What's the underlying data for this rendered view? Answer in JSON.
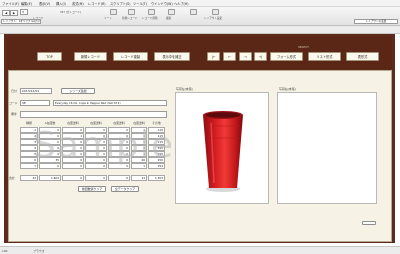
{
  "menu": [
    "ファイル(F)",
    "編集(E)",
    "表示(V)",
    "挿入(I)",
    "書式(M)",
    "レコード(R)",
    "スクリプト(S)",
    "ツール(T)",
    "ウインドウ(W)",
    "ヘルプ(H)"
  ],
  "toolbar": {
    "record_label": "レコード",
    "count_value": "337 (全レコード)",
    "record_number": "3",
    "sort_label": "ソート",
    "new_record_label": "新規レコード",
    "delete_record_label": "レコード削除",
    "find_label": "検索",
    "layout_label": "レイアウト設定",
    "layout_value": "レイアウト: 【オリジナルAのジ..."
  },
  "header": {
    "select_label": "SELECT",
    "buttons": {
      "top": "TOP",
      "new_record": "新規レコード",
      "copy_record": "レコード複製",
      "delete_current": "表示中を補正",
      "first": "|←",
      "prev": "←",
      "next": "→",
      "last": "→|",
      "form_view": "フォーム形式",
      "list_view": "リスト形式",
      "table_view": "表形式"
    }
  },
  "form": {
    "date_label": "日付",
    "date_value": "2013/12/01",
    "date_button": "シリーズ追加",
    "code_label": "コード",
    "code_value": "SE",
    "code_checkbox_label": "ソーダ/ド",
    "name_value": "Everyday 16 Oz. Cups In Pepper Red (Set Of 4)",
    "note_label": "備考",
    "photo_label": "写真左(末尾)",
    "photo2_label": "写真右(末尾)"
  },
  "grid": {
    "headers": [
      "種類",
      "A在庫数",
      "在庫送料",
      "在庫送料",
      "在庫送料",
      "在庫送料",
      "その他"
    ],
    "total_label": "合計",
    "rows": [
      [
        "1",
        "0",
        "0",
        "0",
        "0",
        "1",
        "115"
      ],
      [
        "2",
        "0",
        "1",
        "0",
        "0",
        "1",
        "115"
      ],
      [
        "3",
        "0",
        "0",
        "0",
        "0",
        "0",
        "115"
      ],
      [
        "4",
        "0",
        "0",
        "0",
        "0",
        "2",
        "195"
      ],
      [
        "5",
        "0",
        "0",
        "0",
        "0",
        "1",
        "195"
      ],
      [
        "6",
        "35",
        "0",
        "0",
        "0",
        "26",
        "250"
      ],
      [
        "7",
        "0",
        "0",
        "0",
        "0",
        "1",
        "254"
      ]
    ],
    "totals": [
      "43",
      "1,603",
      "0",
      "0",
      "0",
      "13",
      "1,303"
    ],
    "clear_button": "前回数値クリア",
    "clear_all_button": "全データクリア"
  },
  "watermark": "Sample",
  "status": {
    "zoom": "100",
    "mode": "ブラウズ"
  },
  "colors": {
    "frame": "#5c2b1c",
    "panel": "#f6f3e6",
    "cup": "#d41d20"
  }
}
